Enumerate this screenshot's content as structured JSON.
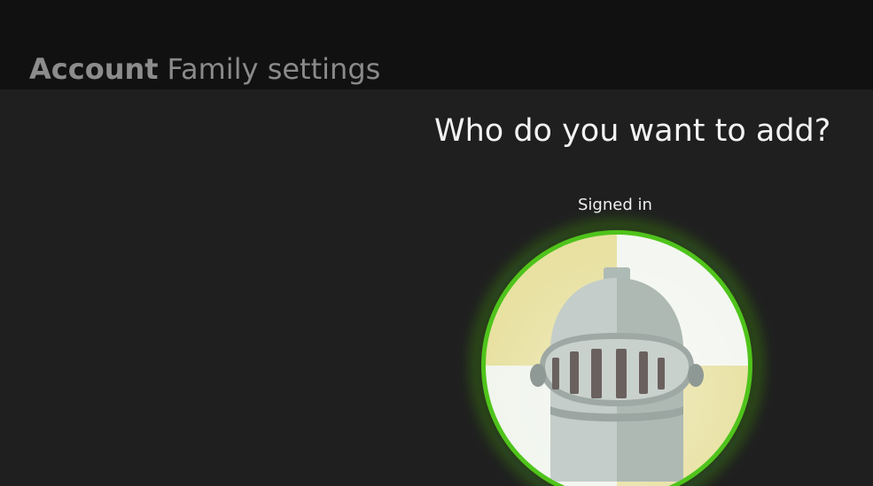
{
  "header": {
    "breadcrumb": {
      "section": "Account",
      "page": "Family settings"
    }
  },
  "main": {
    "title": "Who do you want to add?",
    "profile": {
      "status_label": "Signed in",
      "avatar_icon": "knight-helmet-icon",
      "ring_color": "#4fc31b"
    }
  }
}
